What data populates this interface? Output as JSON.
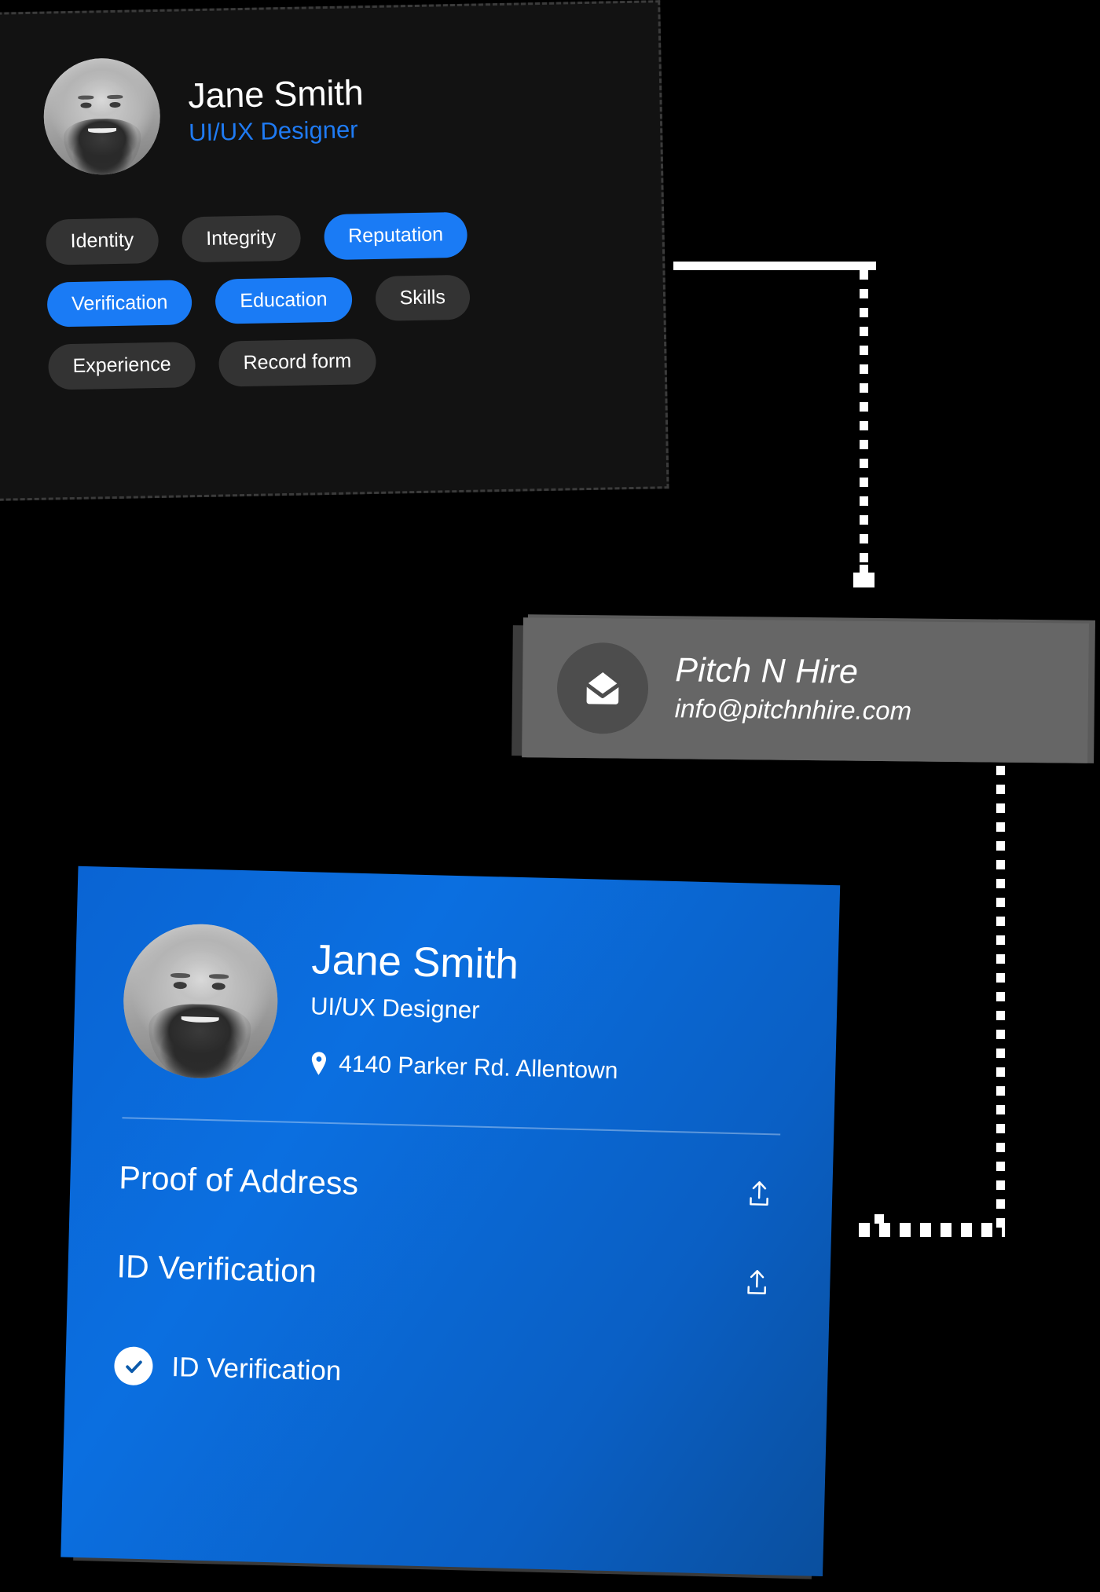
{
  "dark_profile_card": {
    "name": "Jane Smith",
    "role": "UI/UX Designer",
    "avatar_alt": "avatar-photo",
    "tags": [
      {
        "label": "Identity",
        "active": false
      },
      {
        "label": "Integrity",
        "active": false
      },
      {
        "label": "Reputation",
        "active": true
      },
      {
        "label": "Verification",
        "active": true
      },
      {
        "label": "Education",
        "active": true
      },
      {
        "label": "Skills",
        "active": false
      },
      {
        "label": "Experience",
        "active": false
      },
      {
        "label": "Record form",
        "active": false
      }
    ]
  },
  "email_card": {
    "icon": "envelope-icon",
    "company": "Pitch N Hire",
    "email": "info@pitchnhire.com"
  },
  "id_card": {
    "name": "Jane Smith",
    "role": "UI/UX Designer",
    "address": "4140 Parker Rd. Allentown",
    "address_icon": "location-pin-icon",
    "documents": [
      {
        "label": "Proof of Address",
        "action_icon": "upload-icon"
      },
      {
        "label": "ID Verification",
        "action_icon": "upload-icon"
      }
    ],
    "verified": {
      "label": "ID Verification",
      "icon": "check-circle-icon"
    }
  },
  "colors": {
    "background": "#000000",
    "accent_blue": "#1a7bf5",
    "card_dark": "#121212",
    "tag_inactive": "#333333",
    "card_gray": "#666666",
    "card_blue": "#0b6fe0",
    "connector": "#ffffff"
  }
}
